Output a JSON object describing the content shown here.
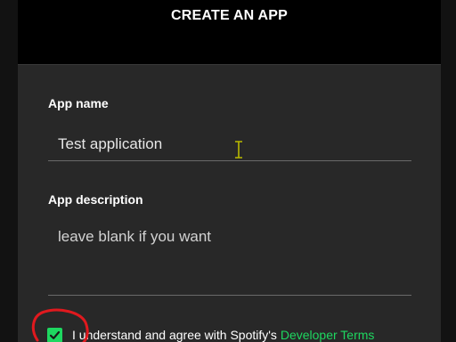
{
  "modal": {
    "title": "CREATE AN APP"
  },
  "form": {
    "app_name": {
      "label": "App name",
      "value": "Test application"
    },
    "app_description": {
      "label": "App description",
      "placeholder": "leave blank if you want"
    },
    "agreement": {
      "checked": true,
      "text": "I understand and agree with Spotify's ",
      "link_text": "Developer Terms"
    }
  },
  "colors": {
    "accent": "#1ed760",
    "annotation": "#e0191e",
    "modal_bg": "#282828",
    "header_bg": "#000000"
  },
  "icons": {
    "checkbox": "check-icon",
    "cursor": "text-cursor-icon"
  }
}
